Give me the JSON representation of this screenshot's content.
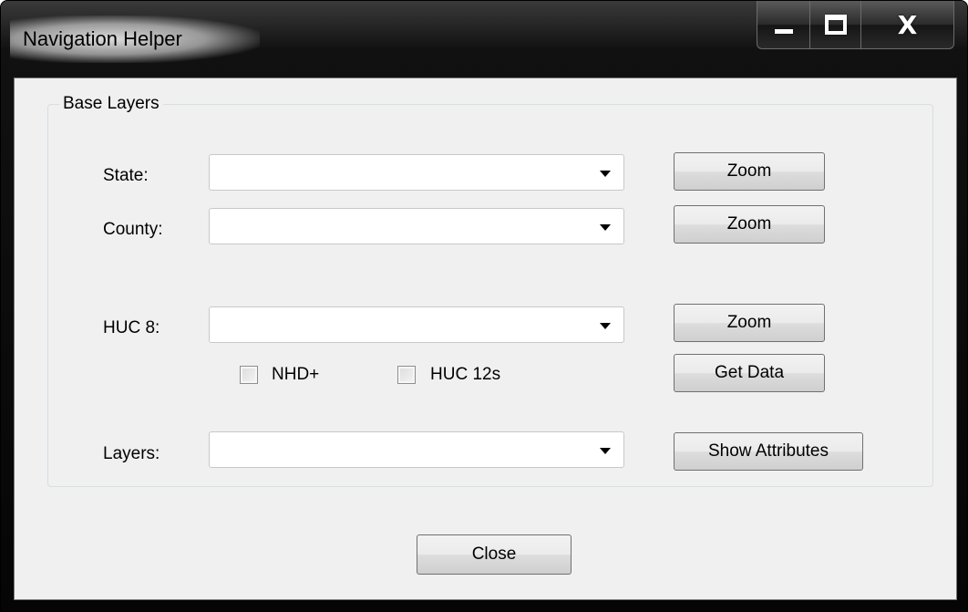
{
  "window": {
    "title": "Navigation Helper",
    "caption": {
      "minimize": "minimize-icon",
      "maximize": "maximize-icon",
      "close": "X"
    }
  },
  "group": {
    "title": "Base Layers"
  },
  "fields": {
    "state": {
      "label": "State:",
      "value": ""
    },
    "county": {
      "label": "County:",
      "value": ""
    },
    "huc8": {
      "label": "HUC 8:",
      "value": ""
    },
    "layers": {
      "label": "Layers:",
      "value": ""
    }
  },
  "buttons": {
    "state_zoom": "Zoom",
    "county_zoom": "Zoom",
    "huc8_zoom": "Zoom",
    "get_data": "Get Data",
    "show_attributes": "Show Attributes",
    "close": "Close"
  },
  "checkboxes": {
    "nhd": {
      "label": "NHD+",
      "checked": false
    },
    "huc12": {
      "label": "HUC 12s",
      "checked": false
    }
  }
}
